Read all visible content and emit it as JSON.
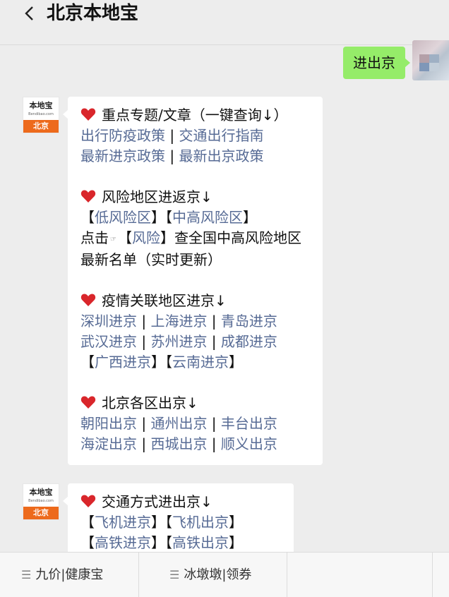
{
  "header": {
    "title": "北京本地宝"
  },
  "user_message": {
    "text": "进出京"
  },
  "bot_avatar": {
    "brand": "本地宝",
    "url": "Bendibao.com",
    "city": "北京"
  },
  "message1": {
    "sec1_title": "重点专题/文章（一键查询↓）",
    "sec1_links": [
      "出行防疫政策",
      "交通出行指南",
      "最新进京政策",
      "最新出京政策"
    ],
    "sec2_title": "风险地区进返京↓",
    "sec2_links": [
      "低风险区",
      "中高风险区"
    ],
    "sec2_text_a": "点击",
    "sec2_link3": "风险",
    "sec2_text_b": "查全国中高风险地区",
    "sec2_text_c": "最新名单（实时更新）",
    "sec3_title": "疫情关联地区进京↓",
    "sec3_links": [
      "深圳进京",
      "上海进京",
      "青岛进京",
      "武汉进京",
      "苏州进京",
      "成都进京",
      "广西进京",
      "云南进京"
    ],
    "sec4_title": "北京各区出京↓",
    "sec4_links": [
      "朝阳出京",
      "通州出京",
      "丰台出京",
      "海淀出京",
      "西城出京",
      "顺义出京"
    ]
  },
  "message2": {
    "title": "交通方式进出京↓",
    "links": [
      "飞机进京",
      "飞机出京",
      "高铁进京",
      "高铁出京"
    ]
  },
  "tabbar": {
    "tabs": [
      "九价|健康宝",
      "冰墩墩|领券"
    ]
  },
  "colors": {
    "link": "#576b95",
    "bubble_user": "#95ec69",
    "accent": "#ed6a1c",
    "heart": "#d9262b"
  }
}
